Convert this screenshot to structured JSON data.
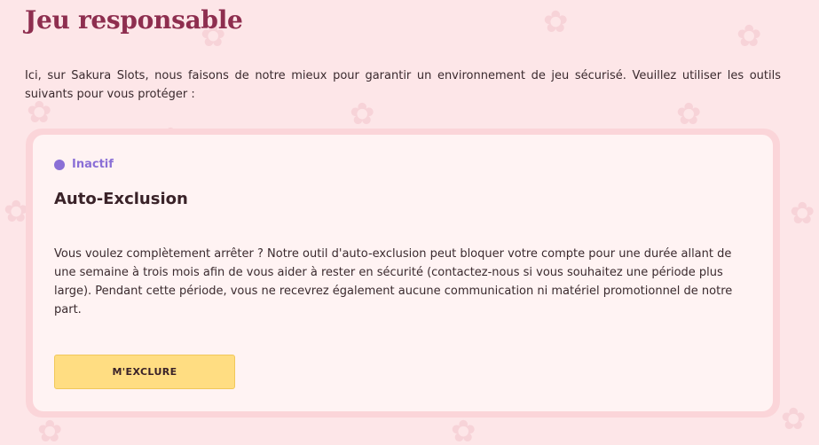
{
  "page": {
    "title": "Jeu responsable",
    "intro": "Ici, sur Sakura Slots, nous faisons de notre mieux pour garantir un environnement de jeu sécurisé. Veuillez utiliser les outils suivants pour vous protéger :"
  },
  "card": {
    "status_label": "Inactif",
    "status_color": "#8a6fd6",
    "title": "Auto-Exclusion",
    "description": "Vous voulez complètement arrêter ? Notre outil d'auto-exclusion peut bloquer votre compte pour une durée allant de une semaine à trois mois afin de vous aider à rester en sécurité (contactez-nous si vous souhaitez une période plus large). Pendant cette période, vous ne recevrez également aucune communication ni matériel promotionnel de notre part.",
    "button_label": "M'EXCLURE"
  },
  "colors": {
    "background": "#fde6e8",
    "title": "#8e2e4f",
    "button": "#ffdd82",
    "card_border": "#fbd5d9"
  },
  "background_pattern_icon": "sakura-flower-icon"
}
